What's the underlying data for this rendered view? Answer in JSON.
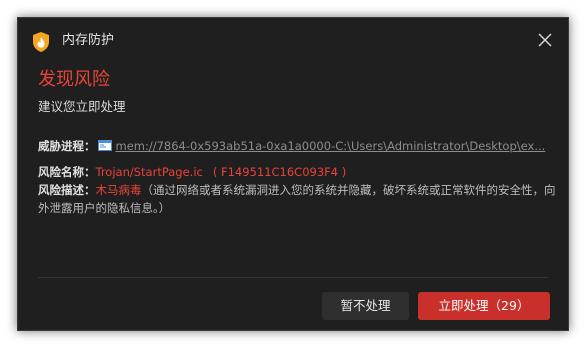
{
  "dialog": {
    "title": "内存防护",
    "close_icon": "close-icon",
    "app_icon": "shield-flame-icon"
  },
  "alert": {
    "headline": "发现风险",
    "subline": "建议您立即处理"
  },
  "details": {
    "process_label": "威胁进程：",
    "process_path": "mem://7864-0x593ab51a-0xa1a0000-C:\\Users\\Administrator\\Desktop\\ex...",
    "risk_name_label": "风险名称：",
    "risk_name": "Trojan/StartPage.ic",
    "risk_hash": "( F149511C16C093F4 )",
    "risk_desc_label": "风险描述：",
    "risk_type": "木马病毒",
    "risk_desc": "（通过网络或者系统漏洞进入您的系统并隐藏，破坏系统或正常软件的安全性，向外泄露用户的隐私信息。）"
  },
  "buttons": {
    "ignore": "暂不处理",
    "handle": "立即处理（29）"
  },
  "colors": {
    "background": "#1f1f1f",
    "accent_red": "#e8443a",
    "primary_button": "#c9302c",
    "secondary_button": "#2f2f2f"
  }
}
